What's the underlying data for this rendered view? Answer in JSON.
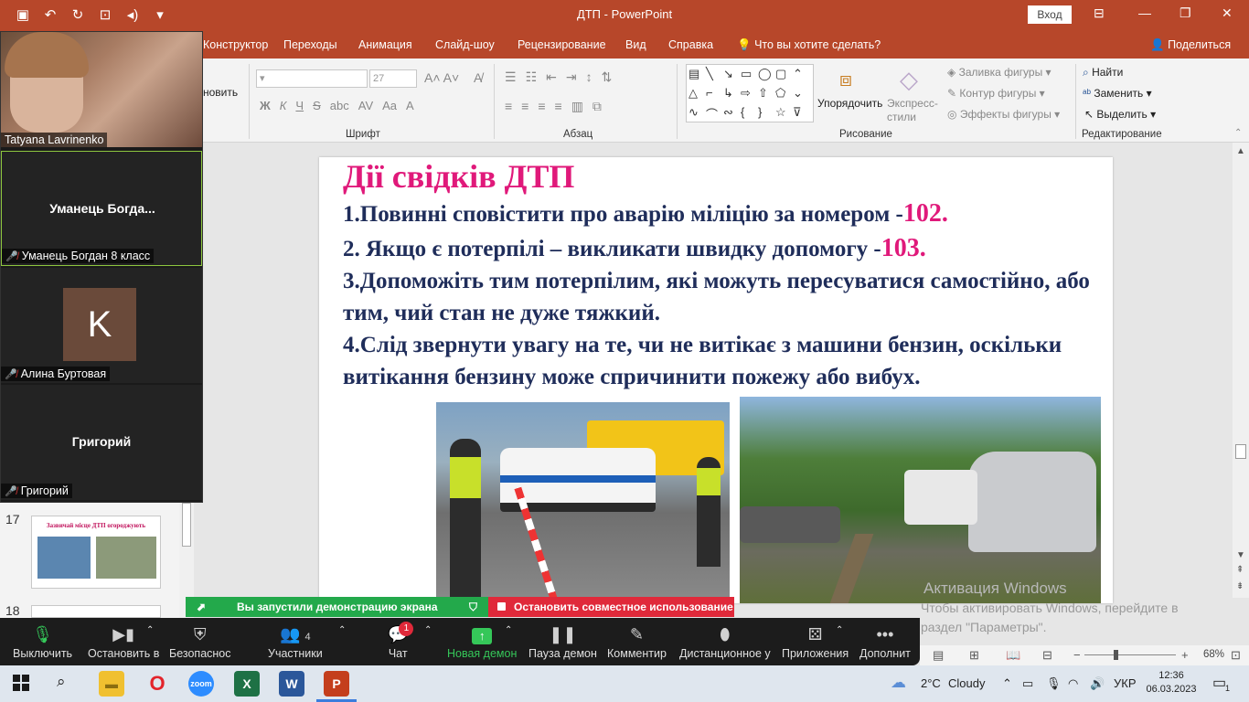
{
  "titlebar": {
    "title": "ДТП  -  PowerPoint",
    "signin": "Вход",
    "qat_icons": [
      "save-icon",
      "undo-icon",
      "redo-icon",
      "present-icon",
      "volume-icon",
      "customize-icon"
    ]
  },
  "tabs": [
    "Конструктор",
    "Переходы",
    "Анимация",
    "Слайд-шоу",
    "Рецензирование",
    "Вид",
    "Справка"
  ],
  "tell_me": "Что вы хотите сделать?",
  "share": "Поделиться",
  "ribbon": {
    "partial_label": "новить",
    "font_size": "27",
    "groups": {
      "font": "Шрифт",
      "paragraph": "Абзац",
      "drawing": "Рисование",
      "editing": "Редактирование"
    },
    "arrange": "Упорядочить",
    "quick_styles": "Экспресс-стили",
    "fill": "Заливка фигуры",
    "outline": "Контур фигуры",
    "effects": "Эффекты фигуры",
    "find": "Найти",
    "replace": "Заменить",
    "select": "Выделить"
  },
  "slide": {
    "heading": "Дії свідків ДТП",
    "line1": "1.Повинні сповістити про аварію міліцію за номером -",
    "num1": "102.",
    "line2": "2. Якщо є потерпілі – викликати швидку допомогу -",
    "num2": "103.",
    "line3": "3.Допоможіть тим потерпілим, які можуть пересуватися самостійно, або тим, чий стан не дуже тяжкий.",
    "line4": "4.Слід звернути увагу на те, чи не витікає з машини бензин, оскільки витікання бензину може спричинити пожежу або вибух."
  },
  "activation": {
    "line1": "Активация Windows",
    "line2": "Чтобы активировать Windows, перейдите в",
    "line3": "раздел \"Параметры\"."
  },
  "thumbnails": [
    {
      "number": "17",
      "title": "Зазвичай місце ДТП огороджують"
    },
    {
      "number": "18",
      "title": ""
    }
  ],
  "participants": [
    {
      "name": "Tatyana Lavrinenko",
      "type": "video"
    },
    {
      "name": "Уманець  Богда...",
      "label": "Уманець Богдан 8 класс",
      "type": "name",
      "active": true
    },
    {
      "name": "Алина Буртовая",
      "initial": "K",
      "type": "avatar"
    },
    {
      "name": "Григорий",
      "label": "Григорий",
      "type": "name"
    }
  ],
  "share_banner": {
    "status": "Вы запустили демонстрацию экрана",
    "stop": "Остановить совместное использование"
  },
  "zoom_toolbar": {
    "mute": "Выключить",
    "stop_video": "Остановить в",
    "security": "Безопаснос",
    "participants": "Участники",
    "participants_count": "4",
    "chat": "Чат",
    "chat_badge": "1",
    "new_share": "Новая демон",
    "pause_share": "Пауза демон",
    "annotate": "Комментир",
    "remote_control": "Дистанционное у",
    "apps": "Приложения",
    "more": "Дополнит"
  },
  "statusbar": {
    "zoom": "68%"
  },
  "taskbar": {
    "weather_temp": "2°C",
    "weather_desc": "Cloudy",
    "lang": "УКР",
    "time": "12:36",
    "date": "06.03.2023",
    "notification_count": "1"
  },
  "colors": {
    "ppt_accent": "#b7472a",
    "heading_pink": "#e0197a",
    "body_navy": "#1f2d5a",
    "zoom_green": "#23a94b",
    "zoom_red": "#e0293a"
  }
}
